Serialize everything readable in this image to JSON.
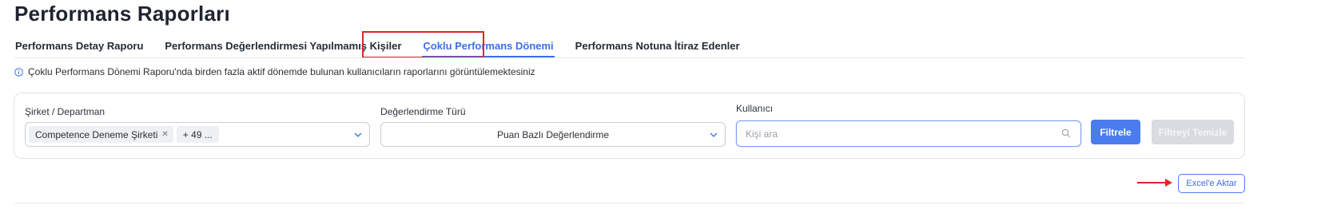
{
  "page": {
    "title": "Performans Raporları"
  },
  "tabs": [
    {
      "label": "Performans Detay Raporu"
    },
    {
      "label": "Performans Değerlendirmesi Yapılmamış Kişiler"
    },
    {
      "label": "Çoklu Performans Dönemi",
      "active": true
    },
    {
      "label": "Performans Notuna İtiraz Edenler"
    }
  ],
  "info": {
    "icon": "info-circle-icon",
    "text": "Çoklu Performans Dönemi Raporu'nda birden fazla aktif dönemde bulunan kullanıcıların raporlarını görüntülemektesiniz"
  },
  "filters": {
    "company": {
      "label": "Şirket / Departman",
      "chip": "Competence Deneme Şirketi",
      "more": "+ 49 ..."
    },
    "evaluation": {
      "label": "Değerlendirme Türü",
      "value": "Puan Bazlı Değerlendirme"
    },
    "user": {
      "label": "Kullanıcı",
      "placeholder": "Kişi ara"
    },
    "filter_button": "Filtrele",
    "clear_button": "Filtreyi Temizle"
  },
  "export": {
    "label": "Excel'e Aktar"
  },
  "colors": {
    "accent": "#3d6fe8",
    "primary_button": "#4a7cf0",
    "highlight": "#e3242b",
    "disabled_button": "#d8dbe0"
  }
}
